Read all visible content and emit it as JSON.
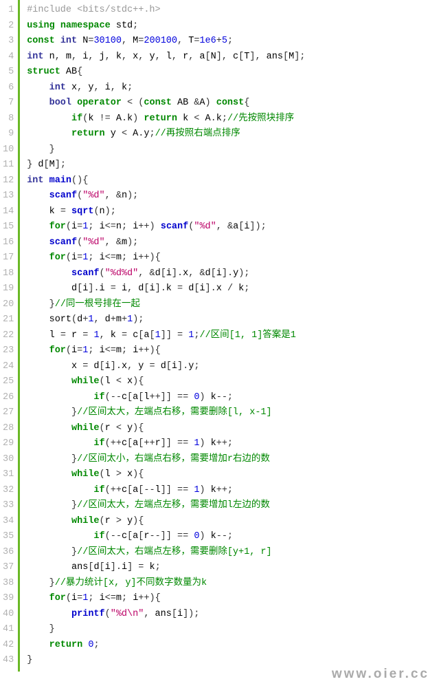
{
  "watermark": "www.oier.cc",
  "lines": [
    {
      "n": "1",
      "html": "<span class='pp'>#include &lt;bits/stdc++.h&gt;</span>"
    },
    {
      "n": "2",
      "html": "<span class='kw'>using</span> <span class='kw'>namespace</span> std<span class='op'>;</span>"
    },
    {
      "n": "3",
      "html": "<span class='kw'>const</span> <span class='ty'>int</span> N<span class='op'>=</span><span class='num'>30100</span><span class='op'>,</span> M<span class='op'>=</span><span class='num'>200100</span><span class='op'>,</span> T<span class='op'>=</span><span class='num'>1e6</span><span class='op'>+</span><span class='num'>5</span><span class='op'>;</span>"
    },
    {
      "n": "4",
      "html": "<span class='ty'>int</span> n<span class='op'>,</span> m<span class='op'>,</span> i<span class='op'>,</span> j<span class='op'>,</span> k<span class='op'>,</span> x<span class='op'>,</span> y<span class='op'>,</span> l<span class='op'>,</span> r<span class='op'>,</span> a<span class='op'>[</span>N<span class='op'>],</span> c<span class='op'>[</span>T<span class='op'>],</span> ans<span class='op'>[</span>M<span class='op'>];</span>"
    },
    {
      "n": "5",
      "html": "<span class='kw'>struct</span> AB<span class='op'>{</span>"
    },
    {
      "n": "6",
      "html": "    <span class='ty'>int</span> x<span class='op'>,</span> y<span class='op'>,</span> i<span class='op'>,</span> k<span class='op'>;</span>"
    },
    {
      "n": "7",
      "html": "    <span class='ty'>bool</span> <span class='kw'>operator</span> <span class='op'>&lt;</span> <span class='op'>(</span><span class='kw'>const</span> AB <span class='op'>&amp;</span>A<span class='op'>)</span> <span class='kw'>const</span><span class='op'>{</span>"
    },
    {
      "n": "8",
      "html": "        <span class='kw'>if</span><span class='op'>(</span>k <span class='op'>!=</span> A<span class='op'>.</span>k<span class='op'>)</span> <span class='kw'>return</span> k <span class='op'>&lt;</span> A<span class='op'>.</span>k<span class='op'>;</span><span class='cmt-zh'>//先按照块排序</span>"
    },
    {
      "n": "9",
      "html": "        <span class='kw'>return</span> y <span class='op'>&lt;</span> A<span class='op'>.</span>y<span class='op'>;</span><span class='cmt-zh'>//再按照右端点排序</span>"
    },
    {
      "n": "10",
      "html": "    <span class='op'>}</span>"
    },
    {
      "n": "11",
      "html": "<span class='op'>}</span> d<span class='op'>[</span>M<span class='op'>];</span>"
    },
    {
      "n": "12",
      "html": "<span class='ty'>int</span> <span class='sfn'>main</span><span class='op'>(){</span>"
    },
    {
      "n": "13",
      "html": "    <span class='sfn'>scanf</span><span class='op'>(</span><span class='str'>\"%d\"</span><span class='op'>,</span> <span class='op'>&amp;</span>n<span class='op'>);</span>"
    },
    {
      "n": "14",
      "html": "    k <span class='op'>=</span> <span class='sfn'>sqrt</span><span class='op'>(</span>n<span class='op'>);</span>"
    },
    {
      "n": "15",
      "html": "    <span class='kw'>for</span><span class='op'>(</span>i<span class='op'>=</span><span class='num'>1</span><span class='op'>;</span> i<span class='op'>&lt;=</span>n<span class='op'>;</span> i<span class='op'>++)</span> <span class='sfn'>scanf</span><span class='op'>(</span><span class='str'>\"%d\"</span><span class='op'>,</span> <span class='op'>&amp;</span>a<span class='op'>[</span>i<span class='op'>]);</span>"
    },
    {
      "n": "16",
      "html": "    <span class='sfn'>scanf</span><span class='op'>(</span><span class='str'>\"%d\"</span><span class='op'>,</span> <span class='op'>&amp;</span>m<span class='op'>);</span>"
    },
    {
      "n": "17",
      "html": "    <span class='kw'>for</span><span class='op'>(</span>i<span class='op'>=</span><span class='num'>1</span><span class='op'>;</span> i<span class='op'>&lt;=</span>m<span class='op'>;</span> i<span class='op'>++){</span>"
    },
    {
      "n": "18",
      "html": "        <span class='sfn'>scanf</span><span class='op'>(</span><span class='str'>\"%d%d\"</span><span class='op'>,</span> <span class='op'>&amp;</span>d<span class='op'>[</span>i<span class='op'>].</span>x<span class='op'>,</span> <span class='op'>&amp;</span>d<span class='op'>[</span>i<span class='op'>].</span>y<span class='op'>);</span>"
    },
    {
      "n": "19",
      "html": "        d<span class='op'>[</span>i<span class='op'>].</span>i <span class='op'>=</span> i<span class='op'>,</span> d<span class='op'>[</span>i<span class='op'>].</span>k <span class='op'>=</span> d<span class='op'>[</span>i<span class='op'>].</span>x <span class='op'>/</span> k<span class='op'>;</span>"
    },
    {
      "n": "20",
      "html": "    <span class='op'>}</span><span class='cmt-zh'>//同一根号排在一起</span>"
    },
    {
      "n": "21",
      "html": "    sort<span class='op'>(</span>d<span class='op'>+</span><span class='num'>1</span><span class='op'>,</span> d<span class='op'>+</span>m<span class='op'>+</span><span class='num'>1</span><span class='op'>);</span>"
    },
    {
      "n": "22",
      "html": "    l <span class='op'>=</span> r <span class='op'>=</span> <span class='num'>1</span><span class='op'>,</span> k <span class='op'>=</span> c<span class='op'>[</span>a<span class='op'>[</span><span class='num'>1</span><span class='op'>]]</span> <span class='op'>=</span> <span class='num'>1</span><span class='op'>;</span><span class='cmt-zh'>//区间[1, 1]答案是1</span>"
    },
    {
      "n": "23",
      "html": "    <span class='kw'>for</span><span class='op'>(</span>i<span class='op'>=</span><span class='num'>1</span><span class='op'>;</span> i<span class='op'>&lt;=</span>m<span class='op'>;</span> i<span class='op'>++){</span>"
    },
    {
      "n": "24",
      "html": "        x <span class='op'>=</span> d<span class='op'>[</span>i<span class='op'>].</span>x<span class='op'>,</span> y <span class='op'>=</span> d<span class='op'>[</span>i<span class='op'>].</span>y<span class='op'>;</span>"
    },
    {
      "n": "25",
      "html": "        <span class='kw'>while</span><span class='op'>(</span>l <span class='op'>&lt;</span> x<span class='op'>){</span>"
    },
    {
      "n": "26",
      "html": "            <span class='kw'>if</span><span class='op'>(--</span>c<span class='op'>[</span>a<span class='op'>[</span>l<span class='op'>++]]</span> <span class='op'>==</span> <span class='num'>0</span><span class='op'>)</span> k<span class='op'>--;</span>"
    },
    {
      "n": "27",
      "html": "        <span class='op'>}</span><span class='cmt-zh'>//区间太大，左端点右移，需要删除[l, x-1]</span>"
    },
    {
      "n": "28",
      "html": "        <span class='kw'>while</span><span class='op'>(</span>r <span class='op'>&lt;</span> y<span class='op'>){</span>"
    },
    {
      "n": "29",
      "html": "            <span class='kw'>if</span><span class='op'>(++</span>c<span class='op'>[</span>a<span class='op'>[++</span>r<span class='op'>]]</span> <span class='op'>==</span> <span class='num'>1</span><span class='op'>)</span> k<span class='op'>++;</span>"
    },
    {
      "n": "30",
      "html": "        <span class='op'>}</span><span class='cmt-zh'>//区间太小，右端点右移，需要增加r右边的数</span>"
    },
    {
      "n": "31",
      "html": "        <span class='kw'>while</span><span class='op'>(</span>l <span class='op'>&gt;</span> x<span class='op'>){</span>"
    },
    {
      "n": "32",
      "html": "            <span class='kw'>if</span><span class='op'>(++</span>c<span class='op'>[</span>a<span class='op'>[--</span>l<span class='op'>]]</span> <span class='op'>==</span> <span class='num'>1</span><span class='op'>)</span> k<span class='op'>++;</span>"
    },
    {
      "n": "33",
      "html": "        <span class='op'>}</span><span class='cmt-zh'>//区间太大，左端点左移，需要增加l左边的数</span>"
    },
    {
      "n": "34",
      "html": "        <span class='kw'>while</span><span class='op'>(</span>r <span class='op'>&gt;</span> y<span class='op'>){</span>"
    },
    {
      "n": "35",
      "html": "            <span class='kw'>if</span><span class='op'>(--</span>c<span class='op'>[</span>a<span class='op'>[</span>r<span class='op'>--]]</span> <span class='op'>==</span> <span class='num'>0</span><span class='op'>)</span> k<span class='op'>--;</span>"
    },
    {
      "n": "36",
      "html": "        <span class='op'>}</span><span class='cmt-zh'>//区间太大，右端点左移，需要删除[y+1, r]</span>"
    },
    {
      "n": "37",
      "html": "        ans<span class='op'>[</span>d<span class='op'>[</span>i<span class='op'>].</span>i<span class='op'>]</span> <span class='op'>=</span> k<span class='op'>;</span>"
    },
    {
      "n": "38",
      "html": "    <span class='op'>}</span><span class='cmt-zh'>//暴力统计[x, y]不同数字数量为k</span>"
    },
    {
      "n": "39",
      "html": "    <span class='kw'>for</span><span class='op'>(</span>i<span class='op'>=</span><span class='num'>1</span><span class='op'>;</span> i<span class='op'>&lt;=</span>m<span class='op'>;</span> i<span class='op'>++){</span>"
    },
    {
      "n": "40",
      "html": "        <span class='sfn'>printf</span><span class='op'>(</span><span class='str'>\"%d\\n\"</span><span class='op'>,</span> ans<span class='op'>[</span>i<span class='op'>]);</span>"
    },
    {
      "n": "41",
      "html": "    <span class='op'>}</span>"
    },
    {
      "n": "42",
      "html": "    <span class='kw'>return</span> <span class='num'>0</span><span class='op'>;</span>"
    },
    {
      "n": "43",
      "html": "<span class='op'>}</span>"
    }
  ]
}
